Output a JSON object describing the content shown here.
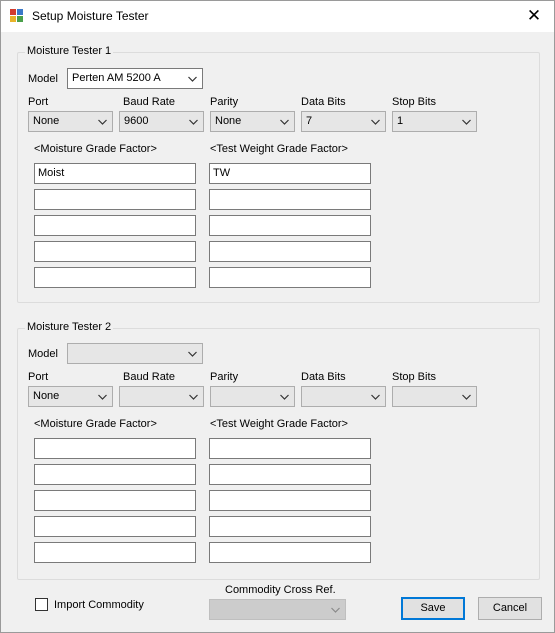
{
  "window": {
    "title": "Setup Moisture Tester",
    "close_glyph": "✕"
  },
  "labels": {
    "model": "Model",
    "port": "Port",
    "baud_rate": "Baud Rate",
    "parity": "Parity",
    "data_bits": "Data Bits",
    "stop_bits": "Stop Bits",
    "moisture_grade_factor": "<Moisture Grade Factor>",
    "test_weight_grade_factor": "<Test Weight Grade Factor>"
  },
  "tester1": {
    "title": "Moisture Tester 1",
    "model": "Perten AM 5200 A",
    "port": "None",
    "baud_rate": "9600",
    "parity": "None",
    "data_bits": "7",
    "stop_bits": "1",
    "moisture_factors": [
      "Moist",
      "",
      "",
      "",
      ""
    ],
    "test_weight_factors": [
      "TW",
      "",
      "",
      "",
      ""
    ]
  },
  "tester2": {
    "title": "Moisture Tester 2",
    "model": "",
    "port": "None",
    "baud_rate": "",
    "parity": "",
    "data_bits": "",
    "stop_bits": "",
    "moisture_factors": [
      "",
      "",
      "",
      "",
      ""
    ],
    "test_weight_factors": [
      "",
      "",
      "",
      "",
      ""
    ]
  },
  "footer": {
    "import_commodity_label": "Import Commodity",
    "import_commodity_checked": false,
    "commodity_cross_ref_label": "Commodity Cross Ref.",
    "commodity_cross_ref_value": "",
    "save_label": "Save",
    "cancel_label": "Cancel"
  },
  "icons": {
    "app": "setup-app-icon",
    "dropdown": "chevron-down-icon",
    "close": "close-icon"
  },
  "colors": {
    "window_bg": "#f0f0f0",
    "default_button_border": "#0078d7",
    "group_border": "#dcdcdc"
  }
}
